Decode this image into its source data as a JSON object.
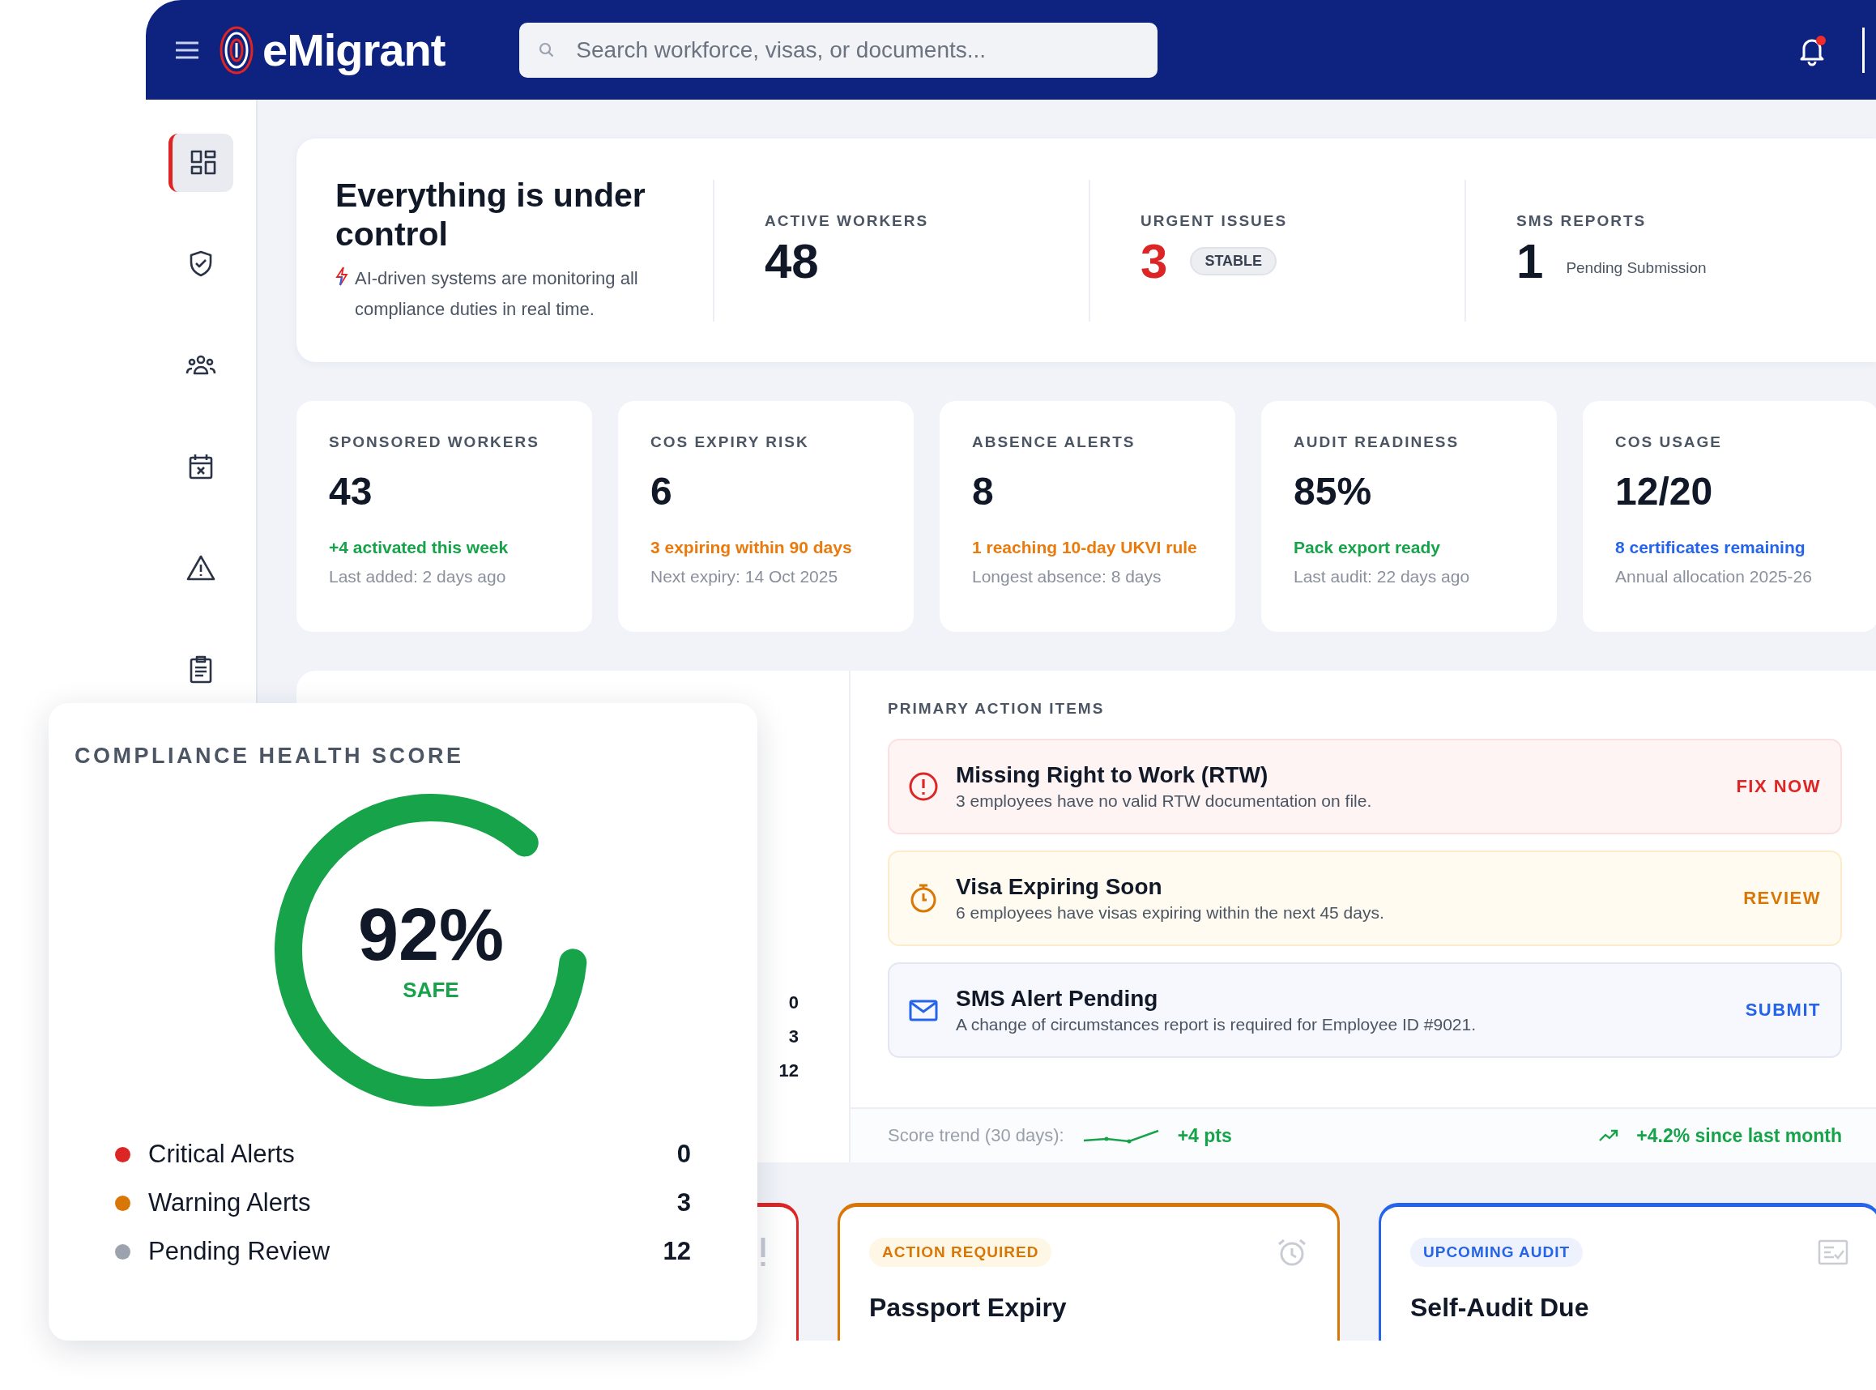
{
  "header": {
    "brand": "eMigrant",
    "search": {
      "placeholder": "Search workforce, visas, or documents..."
    },
    "notification_dot": true
  },
  "sidebar": {
    "items": [
      {
        "kind": "dashboard",
        "selected": true
      },
      {
        "kind": "shield",
        "selected": false
      },
      {
        "kind": "team",
        "selected": false
      },
      {
        "kind": "calendar",
        "selected": false
      },
      {
        "kind": "warning",
        "selected": false
      },
      {
        "kind": "clipboard",
        "selected": false
      }
    ]
  },
  "summary": {
    "title": "Everything is under control",
    "subtitle": "AI-driven systems are monitoring all compliance duties in real time.",
    "stats": [
      {
        "kind": "normal",
        "label": "ACTIVE WORKERS",
        "value": "48"
      },
      {
        "kind": "urgent",
        "label": "URGENT ISSUES",
        "value": "3",
        "badge": "STABLE"
      },
      {
        "kind": "normal",
        "label": "SMS REPORTS",
        "value": "1",
        "note": "Pending Submission"
      }
    ]
  },
  "kpis": [
    {
      "label": "SPONSORED WORKERS",
      "value": "43",
      "highlight": "+4 activated this week",
      "color": "#16a34a",
      "detail": "Last added: 2 days ago"
    },
    {
      "label": "COS EXPIRY RISK",
      "value": "6",
      "highlight": "3 expiring within 90 days",
      "color": "#ea7a0c",
      "detail": "Next expiry: 14 Oct 2025"
    },
    {
      "label": "ABSENCE ALERTS",
      "value": "8",
      "highlight": "1 reaching 10-day UKVI rule",
      "color": "#ea7a0c",
      "detail": "Longest absence: 8 days"
    },
    {
      "label": "AUDIT READINESS",
      "value": "85%",
      "highlight": "Pack export ready",
      "color": "#16a34a",
      "detail": "Last audit: 22 days ago"
    },
    {
      "label": "COS USAGE",
      "value": "12/20",
      "highlight": "8 certificates remaining",
      "color": "#2563eb",
      "detail": "Annual allocation 2025-26"
    }
  ],
  "hidden_panel_values": [
    "0",
    "3",
    "12"
  ],
  "actions": {
    "title": "PRIMARY ACTION ITEMS",
    "items": [
      {
        "kind": "critical",
        "title": "Missing Right to Work (RTW)",
        "description": "3 employees have no valid RTW documentation on file.",
        "action": "FIX NOW"
      },
      {
        "kind": "warning",
        "title": "Visa Expiring Soon",
        "description": "6 employees have visas expiring within the next 45 days.",
        "action": "REVIEW"
      },
      {
        "kind": "info",
        "title": "SMS Alert Pending",
        "description": "A change of circumstances report is required for Employee ID #9021.",
        "action": "SUBMIT"
      }
    ],
    "trend": {
      "label": "Score trend (30 days):",
      "change": "+4 pts",
      "monthly": "+4.2% since last month"
    }
  },
  "bottom_cards": [
    {
      "kind": "critical"
    },
    {
      "kind": "warning",
      "tag": "ACTION REQUIRED",
      "title": "Passport Expiry"
    },
    {
      "kind": "info",
      "tag": "UPCOMING AUDIT",
      "title": "Self-Audit Due"
    }
  ],
  "health": {
    "title": "COMPLIANCE HEALTH SCORE",
    "score": "92%",
    "status": "SAFE",
    "level": 0.85,
    "legend": [
      {
        "label": "Critical Alerts",
        "value": "0",
        "color": "#dc2626"
      },
      {
        "label": "Warning Alerts",
        "value": "3",
        "color": "#d97706"
      },
      {
        "label": "Pending Review",
        "value": "12",
        "color": "#9ca3af"
      }
    ]
  }
}
